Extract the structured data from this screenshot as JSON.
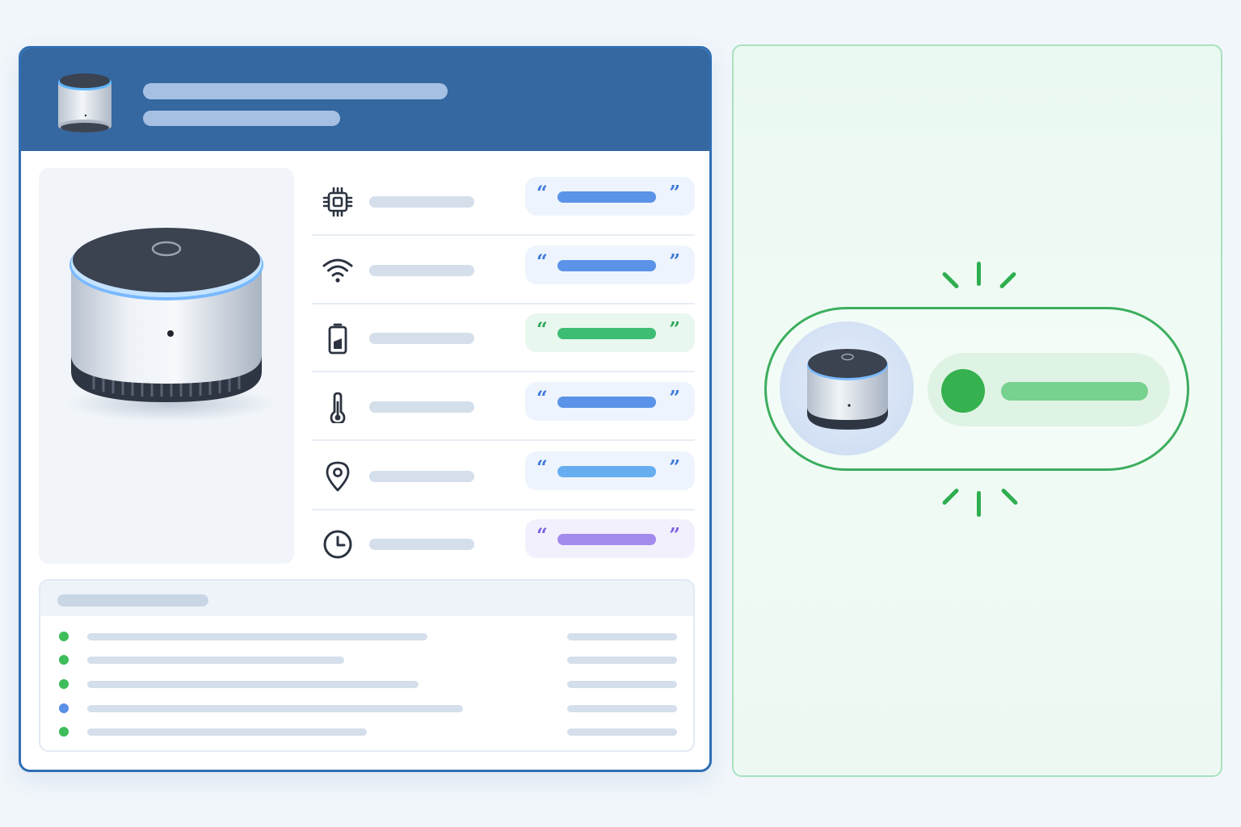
{
  "device_card": {
    "title": "",
    "subtitle": "",
    "specs": [
      {
        "icon": "chip-icon",
        "label": "",
        "value": "",
        "accent": "#5a93e8",
        "chip_bg": "#eef4fd",
        "quote_color": "#3f7ad8"
      },
      {
        "icon": "wifi-icon",
        "label": "",
        "value": "",
        "accent": "#5a93e8",
        "chip_bg": "#eef4fd",
        "quote_color": "#3f7ad8"
      },
      {
        "icon": "battery-icon",
        "label": "",
        "value": "",
        "accent": "#3dbd74",
        "chip_bg": "#e8f8ee",
        "quote_color": "#2fa85e"
      },
      {
        "icon": "thermometer-icon",
        "label": "",
        "value": "",
        "accent": "#5a93e8",
        "chip_bg": "#eef4fd",
        "quote_color": "#3f7ad8"
      },
      {
        "icon": "location-pin-icon",
        "label": "",
        "value": "",
        "accent": "#66aef0",
        "chip_bg": "#eef4fd",
        "quote_color": "#3f7ad8"
      },
      {
        "icon": "clock-icon",
        "label": "",
        "value": "",
        "accent": "#a38bee",
        "chip_bg": "#f3f0fd",
        "quote_color": "#7e63e0"
      }
    ],
    "quote_open": "“",
    "quote_close": "”"
  },
  "activity_log": {
    "title": "",
    "entries": [
      {
        "text": "",
        "time": "",
        "status_color": "#3dbd5c"
      },
      {
        "text": "",
        "time": "",
        "status_color": "#3dbd5c"
      },
      {
        "text": "",
        "time": "",
        "status_color": "#3dbd5c"
      },
      {
        "text": "",
        "time": "",
        "status_color": "#5a8fe8"
      },
      {
        "text": "",
        "time": "",
        "status_color": "#3dbd5c"
      }
    ]
  },
  "pairing": {
    "status_text": "",
    "status_color": "#36b14f",
    "connected": true
  },
  "colors": {
    "header": "#3568a0",
    "panel_border": "#2f6fb4",
    "success": "#36b14f"
  }
}
